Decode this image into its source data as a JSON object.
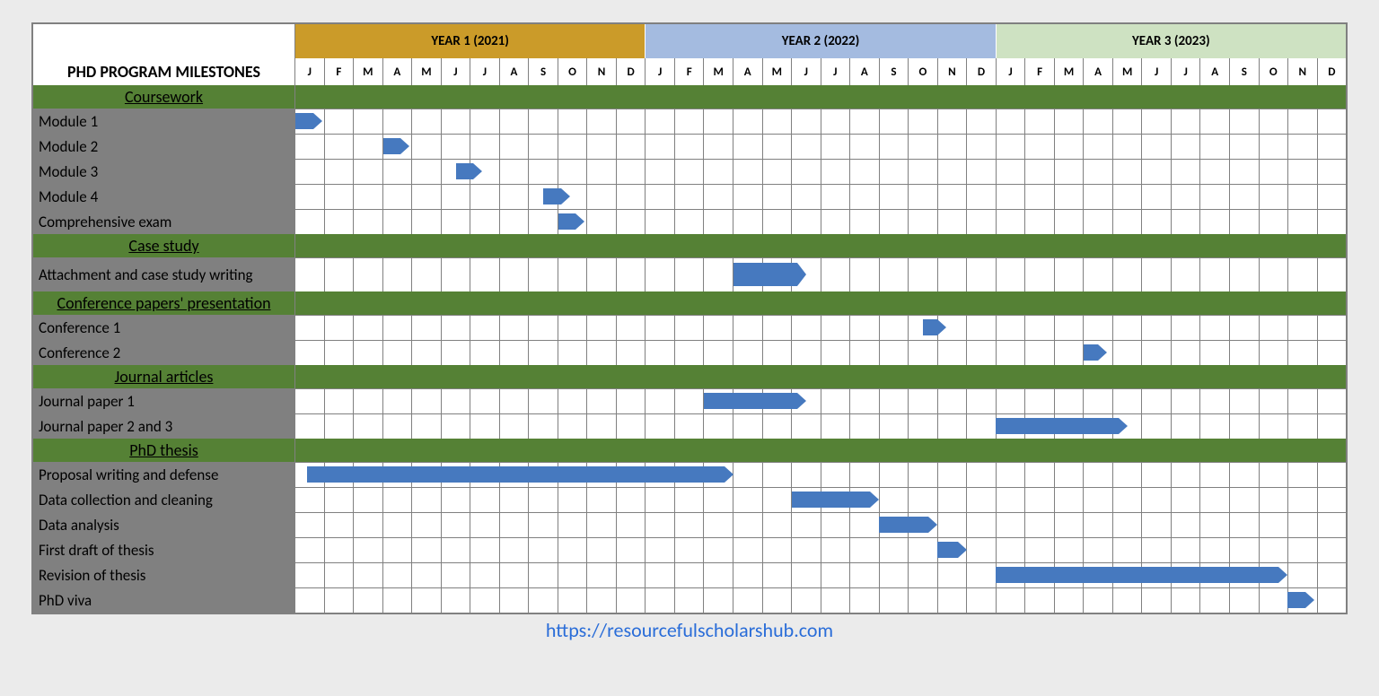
{
  "title": "PHD PROGRAM MILESTONES",
  "years": [
    {
      "label": "YEAR 1 (2021)",
      "class": "y1"
    },
    {
      "label": "YEAR 2 (2022)",
      "class": "y2"
    },
    {
      "label": "YEAR 3 (2023)",
      "class": "y3"
    }
  ],
  "months": [
    "J",
    "F",
    "M",
    "A",
    "M",
    "J",
    "J",
    "A",
    "S",
    "O",
    "N",
    "D"
  ],
  "total_months": 36,
  "rows": [
    {
      "type": "section",
      "label": "Coursework"
    },
    {
      "type": "task",
      "label": "Module 1",
      "start": 0,
      "duration_body": 0.6,
      "height": 18
    },
    {
      "type": "task",
      "label": "Module 2",
      "start": 3,
      "duration_body": 0.6,
      "height": 18
    },
    {
      "type": "task",
      "label": "Module 3",
      "start": 5.5,
      "duration_body": 0.6,
      "height": 18
    },
    {
      "type": "task",
      "label": "Module 4",
      "start": 8.5,
      "duration_body": 0.6,
      "height": 18
    },
    {
      "type": "task",
      "label": "Comprehensive exam",
      "start": 9,
      "duration_body": 0.6,
      "height": 18
    },
    {
      "type": "section",
      "label": "Case study"
    },
    {
      "type": "task",
      "tall": true,
      "label": "Attachment and case study writing",
      "start": 15,
      "duration_body": 2.2,
      "height": 26
    },
    {
      "type": "section",
      "label": "Conference papers' presentation"
    },
    {
      "type": "task",
      "label": "Conference 1",
      "start": 21.5,
      "duration_body": 0.5,
      "height": 18
    },
    {
      "type": "task",
      "label": "Conference 2",
      "start": 27,
      "duration_body": 0.5,
      "height": 18
    },
    {
      "type": "section",
      "label": "Journal articles"
    },
    {
      "type": "task",
      "label": "Journal paper 1",
      "start": 14,
      "duration_body": 3.2,
      "height": 18
    },
    {
      "type": "task",
      "label": "Journal paper 2 and 3",
      "start": 24,
      "duration_body": 4.2,
      "height": 18
    },
    {
      "type": "section",
      "label": "PhD thesis"
    },
    {
      "type": "task",
      "label": "Proposal writing and defense",
      "start": 0.4,
      "duration_body": 14.3,
      "height": 18
    },
    {
      "type": "task",
      "label": "Data collection and cleaning",
      "start": 17,
      "duration_body": 2.7,
      "height": 18
    },
    {
      "type": "task",
      "label": "Data analysis",
      "start": 20,
      "duration_body": 1.7,
      "height": 18
    },
    {
      "type": "task",
      "label": "First draft of thesis",
      "start": 22,
      "duration_body": 0.7,
      "height": 18
    },
    {
      "type": "task",
      "label": "Revision of thesis",
      "start": 24,
      "duration_body": 9.7,
      "height": 18
    },
    {
      "type": "task",
      "label": "PhD viva",
      "start": 34,
      "duration_body": 0.6,
      "height": 18
    }
  ],
  "footer_url_text": "https://resourcefulscholarshub.com",
  "chart_data": {
    "type": "gantt",
    "title": "PHD PROGRAM MILESTONES",
    "x_unit": "month_index (0 = Jan 2021)",
    "x_range": [
      0,
      36
    ],
    "year_labels": [
      "YEAR 1 (2021)",
      "YEAR 2 (2022)",
      "YEAR 3 (2023)"
    ],
    "month_pattern": [
      "J",
      "F",
      "M",
      "A",
      "M",
      "J",
      "J",
      "A",
      "S",
      "O",
      "N",
      "D"
    ],
    "sections": [
      {
        "name": "Coursework",
        "tasks": [
          {
            "name": "Module 1",
            "start": 0,
            "end": 1
          },
          {
            "name": "Module 2",
            "start": 3,
            "end": 4
          },
          {
            "name": "Module 3",
            "start": 5.5,
            "end": 6.5
          },
          {
            "name": "Module 4",
            "start": 8.5,
            "end": 9.5
          },
          {
            "name": "Comprehensive exam",
            "start": 9,
            "end": 10
          }
        ]
      },
      {
        "name": "Case study",
        "tasks": [
          {
            "name": "Attachment and case study writing",
            "start": 15,
            "end": 17.5
          }
        ]
      },
      {
        "name": "Conference papers' presentation",
        "tasks": [
          {
            "name": "Conference 1",
            "start": 21.5,
            "end": 22.5
          },
          {
            "name": "Conference 2",
            "start": 27,
            "end": 28
          }
        ]
      },
      {
        "name": "Journal articles",
        "tasks": [
          {
            "name": "Journal paper 1",
            "start": 14,
            "end": 17.5
          },
          {
            "name": "Journal paper 2 and 3",
            "start": 24,
            "end": 28.5
          }
        ]
      },
      {
        "name": "PhD thesis",
        "tasks": [
          {
            "name": "Proposal writing and defense",
            "start": 0.4,
            "end": 15
          },
          {
            "name": "Data collection and cleaning",
            "start": 17,
            "end": 20
          },
          {
            "name": "Data analysis",
            "start": 20,
            "end": 22
          },
          {
            "name": "First draft of thesis",
            "start": 22,
            "end": 23
          },
          {
            "name": "Revision of thesis",
            "start": 24,
            "end": 34
          },
          {
            "name": "PhD viva",
            "start": 34,
            "end": 35
          }
        ]
      }
    ]
  }
}
